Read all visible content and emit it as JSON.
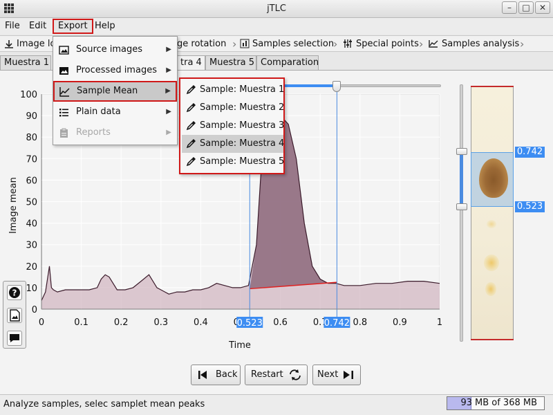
{
  "window": {
    "title": "jTLC"
  },
  "menubar": {
    "file": "File",
    "edit": "Edit",
    "export": "Export",
    "help": "Help"
  },
  "wizard": {
    "steps": [
      "Image lo",
      "ge rotation",
      "Samples selection",
      "Special points",
      "Samples analysis"
    ]
  },
  "tabs": [
    "Muestra 1",
    "tra 4",
    "Muestra 5",
    "Comparation"
  ],
  "export_menu": {
    "items": [
      {
        "label": "Source images",
        "icon": "image-icon",
        "enabled": true
      },
      {
        "label": "Processed images",
        "icon": "image-filled-icon",
        "enabled": true
      },
      {
        "label": "Sample Mean",
        "icon": "line-chart-icon",
        "enabled": true
      },
      {
        "label": "Plain data",
        "icon": "list-icon",
        "enabled": true
      },
      {
        "label": "Reports",
        "icon": "clipboard-icon",
        "enabled": false
      }
    ]
  },
  "sample_submenu": {
    "items": [
      "Sample: Muestra 1",
      "Sample: Muestra 2",
      "Sample: Muestra 3",
      "Sample: Muestra 4",
      "Sample: Muestra 5"
    ],
    "selected_index": 3
  },
  "chart_data": {
    "type": "area",
    "xlabel": "Time",
    "ylabel": "Image mean",
    "xlim": [
      0,
      1
    ],
    "ylim": [
      0,
      100
    ],
    "x_ticks": [
      "0",
      "0.1",
      "0.2",
      "0.3",
      "0.4",
      "0.5",
      "0.6",
      "0.7",
      "0.8",
      "0.9",
      "1"
    ],
    "y_ticks": [
      "0",
      "10",
      "20",
      "30",
      "40",
      "50",
      "60",
      "70",
      "80",
      "90",
      "100"
    ],
    "x": [
      0,
      0.01,
      0.02,
      0.025,
      0.03,
      0.04,
      0.06,
      0.08,
      0.1,
      0.12,
      0.14,
      0.15,
      0.16,
      0.17,
      0.19,
      0.21,
      0.23,
      0.25,
      0.27,
      0.29,
      0.3,
      0.31,
      0.32,
      0.34,
      0.36,
      0.38,
      0.4,
      0.42,
      0.44,
      0.46,
      0.48,
      0.5,
      0.52,
      0.54,
      0.55,
      0.56,
      0.58,
      0.6,
      0.62,
      0.64,
      0.66,
      0.68,
      0.7,
      0.72,
      0.74,
      0.76,
      0.78,
      0.8,
      0.84,
      0.88,
      0.92,
      0.96,
      1.0
    ],
    "y": [
      4,
      8,
      20,
      10,
      9,
      8,
      9,
      9,
      9,
      9,
      10,
      14,
      16,
      15,
      9,
      9,
      10,
      13,
      16,
      10,
      9,
      8,
      7,
      8,
      8,
      9,
      9,
      10,
      12,
      11,
      10,
      10,
      11,
      30,
      60,
      85,
      92,
      90,
      86,
      70,
      40,
      20,
      14,
      12,
      12,
      11,
      11,
      11,
      12,
      12,
      13,
      13,
      12
    ],
    "baseline": {
      "x1": 0.523,
      "y1": 9.5,
      "x2": 0.742,
      "y2": 12.5
    },
    "peak_region": {
      "start": 0.523,
      "end": 0.742
    },
    "range_labels": [
      "0.523",
      "0.742"
    ],
    "line_color": "#3a1a2a",
    "fill_color": "#c9a9b6",
    "peak_fill_color": "#8d6a7d",
    "baseline_color": "#e02020"
  },
  "tlc_strip": {
    "upper_label": "0.742",
    "lower_label": "0.523"
  },
  "side_tools": [
    "help-icon",
    "image-export-icon",
    "comment-icon"
  ],
  "nav": {
    "back": "Back",
    "restart": "Restart",
    "next": "Next"
  },
  "status": {
    "message": "Analyze samples, selec samplet mean peaks",
    "mem_used": "93",
    "mem_text": "MB of 368 MB",
    "mem_fraction": 0.253
  }
}
